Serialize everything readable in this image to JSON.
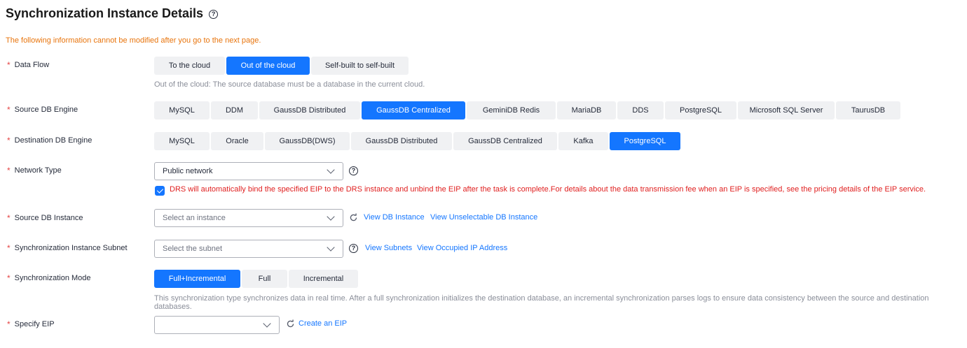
{
  "title": "Synchronization Instance Details",
  "notice": "The following information cannot be modified after you go to the next page.",
  "required_mark": "*",
  "help_glyph": "?",
  "data_flow": {
    "label": "Data Flow",
    "options": [
      "To the cloud",
      "Out of the cloud",
      "Self-built to self-built"
    ],
    "selected": "Out of the cloud",
    "hint": "Out of the cloud: The source database must be a database in the current cloud."
  },
  "source_engine": {
    "label": "Source DB Engine",
    "options": [
      "MySQL",
      "DDM",
      "GaussDB Distributed",
      "GaussDB Centralized",
      "GeminiDB Redis",
      "MariaDB",
      "DDS",
      "PostgreSQL",
      "Microsoft SQL Server",
      "TaurusDB"
    ],
    "selected": "GaussDB Centralized"
  },
  "destination_engine": {
    "label": "Destination DB Engine",
    "options": [
      "MySQL",
      "Oracle",
      "GaussDB(DWS)",
      "GaussDB Distributed",
      "GaussDB Centralized",
      "Kafka",
      "PostgreSQL"
    ],
    "selected": "PostgreSQL"
  },
  "network_type": {
    "label": "Network Type",
    "value": "Public network",
    "eip_checkbox_checked": true,
    "eip_notice": "DRS will automatically bind the specified EIP to the DRS instance and unbind the EIP after the task is complete.For details about the data transmission fee when an EIP is specified, see the pricing details of the EIP service."
  },
  "source_instance": {
    "label": "Source DB Instance",
    "placeholder": "Select an instance",
    "link_view": "View DB Instance",
    "link_unselectable": "View Unselectable DB Instance"
  },
  "subnet": {
    "label": "Synchronization Instance Subnet",
    "placeholder": "Select the subnet",
    "link_view": "View Subnets",
    "link_occupied": "View Occupied IP Address"
  },
  "sync_mode": {
    "label": "Synchronization Mode",
    "options": [
      "Full+Incremental",
      "Full",
      "Incremental"
    ],
    "selected": "Full+Incremental",
    "hint": "This synchronization type synchronizes data in real time. After a full synchronization initializes the destination database, an incremental synchronization parses logs to ensure data consistency between the source and destination databases."
  },
  "eip": {
    "label": "Specify EIP",
    "value": "",
    "link_create": "Create an EIP"
  },
  "colors": {
    "accent": "#1476ff",
    "required": "#e54545",
    "notice": "#e8740c",
    "warning": "#e02020",
    "hint": "#8a8e99"
  }
}
